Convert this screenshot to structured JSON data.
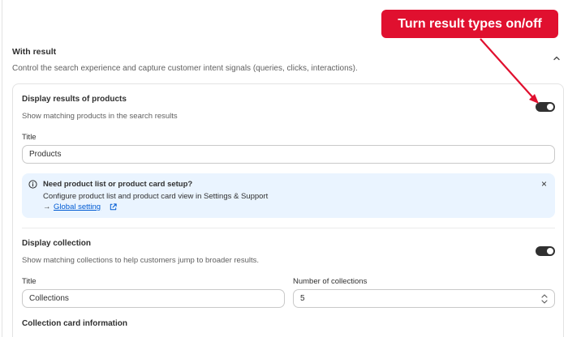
{
  "section": {
    "title": "With result",
    "description": "Control the search experience and capture customer intent signals (queries, clicks, interactions)."
  },
  "products": {
    "title": "Display results of products",
    "description": "Show matching products in the search results",
    "toggle_on": true,
    "field_label": "Title",
    "field_value": "Products"
  },
  "banner": {
    "title": "Need product list or product card setup?",
    "description": "Configure product list and product card view in Settings & Support",
    "arrow": "→",
    "link_label": "Global setting",
    "close_glyph": "×"
  },
  "collection": {
    "title": "Display collection",
    "description": "Show matching collections to help customers jump to broader results.",
    "toggle_on": true,
    "title_label": "Title",
    "title_value": "Collections",
    "count_label": "Number of collections",
    "count_value": "5",
    "card_info_heading": "Collection card information"
  },
  "annotation": {
    "callout_text": "Turn result types on/off",
    "color": "#e0102f"
  },
  "colors": {
    "toggle": "#303030",
    "banner_bg": "#eaf4ff",
    "link": "#005bd3"
  }
}
